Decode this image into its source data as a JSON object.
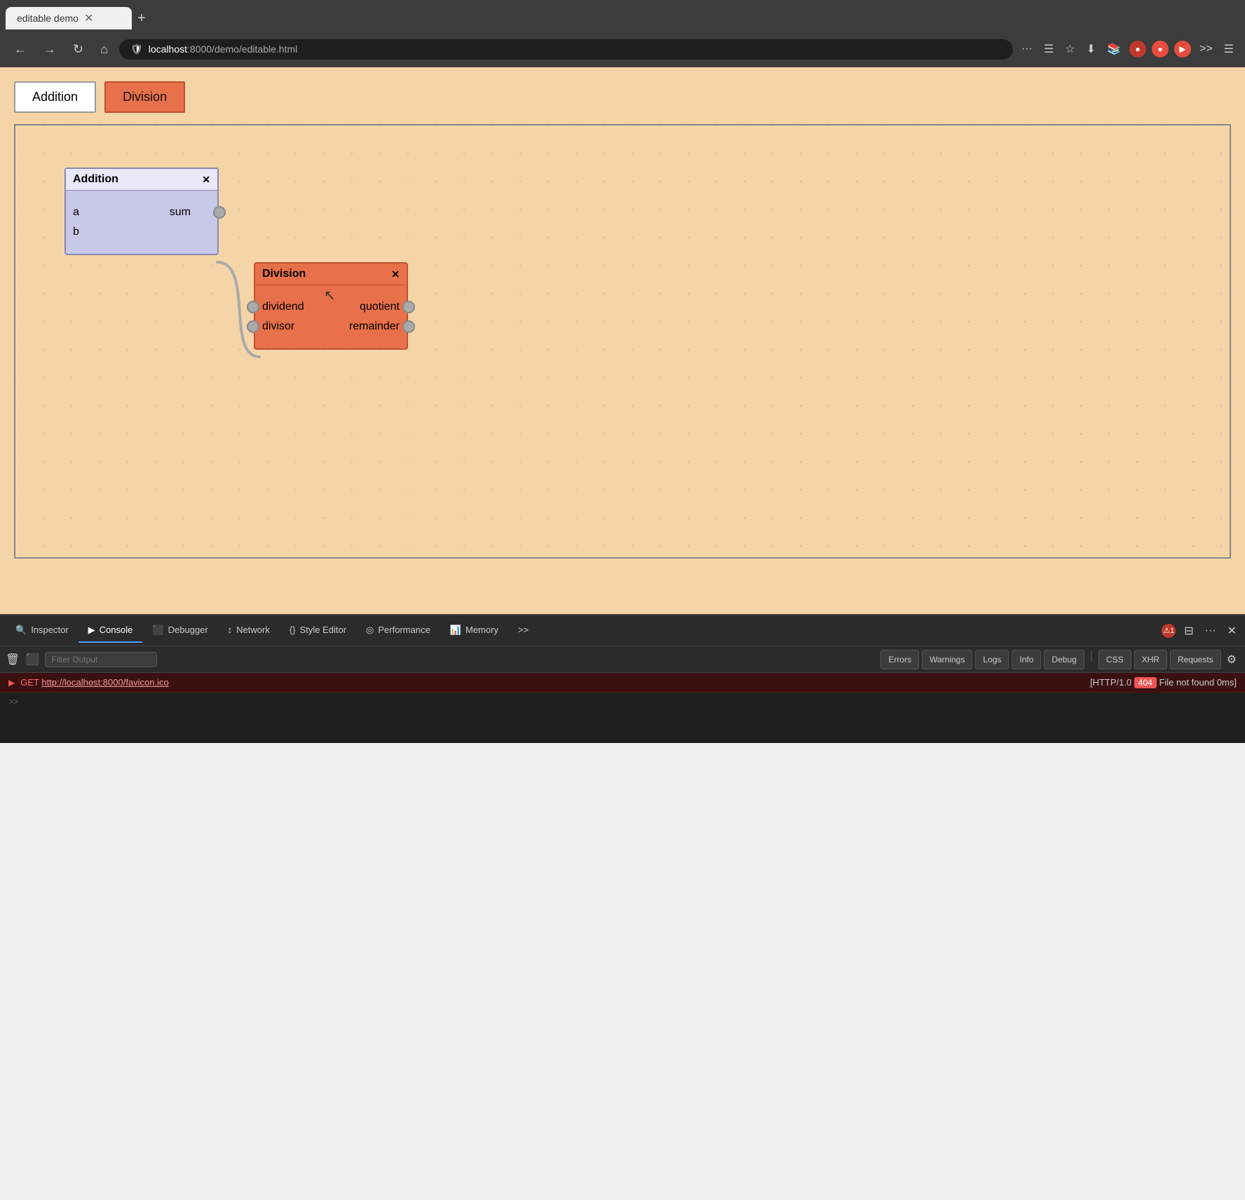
{
  "browser": {
    "tab_title": "editable demo",
    "url_prefix": "localhost",
    "url_path": ":8000/demo/editable.html",
    "url_full": "localhost:8000/demo/editable.html"
  },
  "toolbar": {
    "addition_label": "Addition",
    "division_label": "Division"
  },
  "nodes": {
    "addition": {
      "title": "Addition",
      "port_a": "a",
      "port_b": "b",
      "port_sum": "sum"
    },
    "division": {
      "title": "Division",
      "port_dividend": "dividend",
      "port_divisor": "divisor",
      "port_quotient": "quotient",
      "port_remainder": "remainder"
    }
  },
  "devtools": {
    "tabs": [
      {
        "id": "inspector",
        "label": "Inspector",
        "icon": "🔍"
      },
      {
        "id": "console",
        "label": "Console",
        "icon": "▶"
      },
      {
        "id": "debugger",
        "label": "Debugger",
        "icon": "⬛"
      },
      {
        "id": "network",
        "label": "Network",
        "icon": "↕"
      },
      {
        "id": "style-editor",
        "label": "Style Editor",
        "icon": "{}"
      },
      {
        "id": "performance",
        "label": "Performance",
        "icon": "◎"
      },
      {
        "id": "memory",
        "label": "Memory",
        "icon": "📊"
      }
    ],
    "active_tab": "console",
    "error_count": "1",
    "filter_placeholder": "Filter Output",
    "filter_buttons": [
      "Errors",
      "Warnings",
      "Logs",
      "Info",
      "Debug"
    ],
    "extra_buttons": [
      "CSS",
      "XHR",
      "Requests"
    ],
    "console_error": {
      "method": "GET",
      "url": "http://localhost:8000/favicon.ico",
      "status": "[HTTP/1.0",
      "status_code": "404",
      "message": "File not found 0ms]"
    }
  }
}
